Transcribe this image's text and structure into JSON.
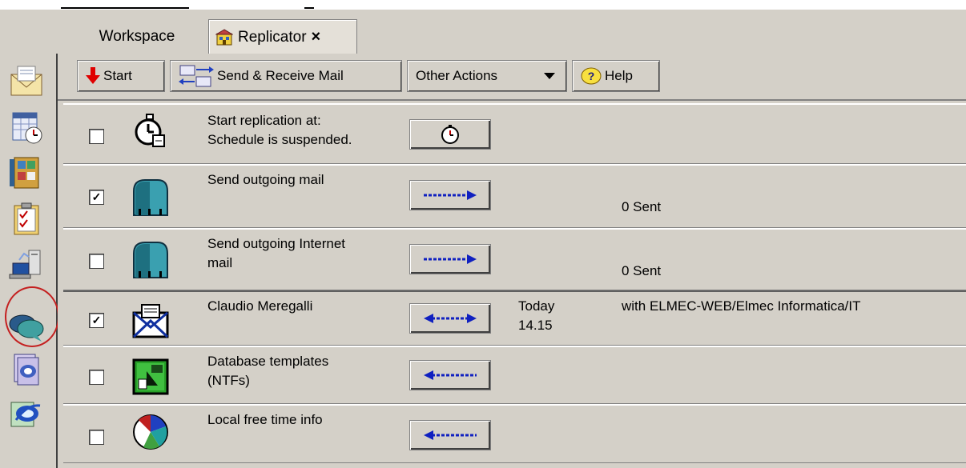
{
  "tabs": [
    {
      "label": "Workspace"
    },
    {
      "label": "Replicator",
      "close": "×"
    }
  ],
  "sidebar": {
    "items": [
      {
        "icon": "mail-icon"
      },
      {
        "icon": "calendar-icon"
      },
      {
        "icon": "address-book-icon"
      },
      {
        "icon": "todo-icon"
      },
      {
        "icon": "replicator-icon",
        "selected": true
      },
      {
        "icon": "chat-icon"
      },
      {
        "icon": "databases-icon"
      },
      {
        "icon": "browser-icon"
      }
    ]
  },
  "toolbar": {
    "start_label": "Start",
    "send_receive_label": "Send & Receive Mail",
    "other_actions_label": "Other Actions",
    "help_label": "Help"
  },
  "rows": [
    {
      "checked": false,
      "icon": "stopwatch-icon",
      "line1": "Start replication at:",
      "line2": "Schedule is suspended.",
      "action": "stopwatch-icon",
      "when1": "",
      "when2": "",
      "info": ""
    },
    {
      "checked": true,
      "icon": "mailbox-icon",
      "line1": "Send outgoing mail",
      "line2": "",
      "action": "arrow-right-icon",
      "when1": "",
      "when2": "",
      "info": "0 Sent"
    },
    {
      "checked": false,
      "icon": "mailbox-icon",
      "line1": "Send outgoing Internet",
      "line2": "mail",
      "action": "arrow-right-icon",
      "when1": "",
      "when2": "",
      "info": "0 Sent"
    },
    {
      "checked": true,
      "icon": "envelope-icon",
      "line1": "Claudio Meregalli",
      "line2": "",
      "action": "arrow-both-icon",
      "when1": "Today",
      "when2": "14.15",
      "info": "with ELMEC-WEB/Elmec Informatica/IT"
    },
    {
      "checked": false,
      "icon": "template-icon",
      "line1": "Database templates",
      "line2": "(NTFs)",
      "action": "arrow-left-icon",
      "when1": "",
      "when2": "",
      "info": ""
    },
    {
      "checked": false,
      "icon": "pie-icon",
      "line1": "Local free time info",
      "line2": "",
      "action": "arrow-left-icon",
      "when1": "",
      "when2": "",
      "info": ""
    }
  ],
  "check_glyph": "✓"
}
